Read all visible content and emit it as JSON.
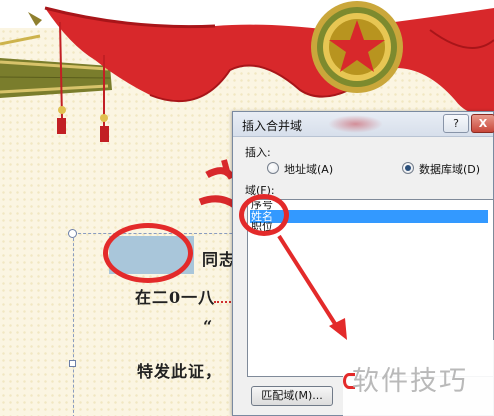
{
  "document": {
    "line1_suffix": "同志",
    "line2_text": "在二0一八",
    "line3_text": "“",
    "line4_text": "特发此证，"
  },
  "dialog": {
    "title": "插入合并域",
    "help_label": "?",
    "close_label": "X",
    "insert_label": "插入:",
    "radio_address": "地址域(A)",
    "radio_database": "数据库域(D)",
    "radio_selected": "database",
    "field_label": "域(F):",
    "fields": [
      "序号",
      "姓名",
      "职位"
    ],
    "selected_field": "姓名",
    "match_button": "匹配域(M)..."
  },
  "watermark": {
    "text": "软件技巧"
  },
  "colors": {
    "accent_red": "#e32a2a",
    "selection_blue": "#3399ff",
    "merge_field_fill": "#a9c6da"
  }
}
